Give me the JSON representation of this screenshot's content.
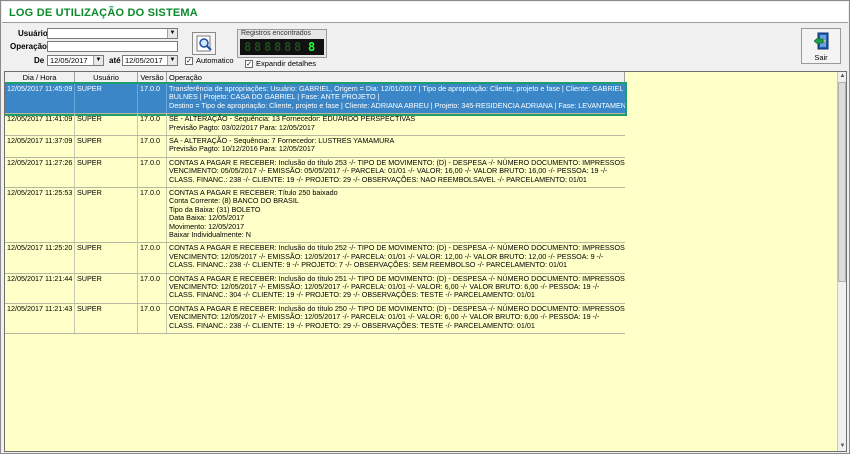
{
  "window": {
    "title": "LOG DE UTILIZAÇÃO DO SISTEMA"
  },
  "filters": {
    "usuario_label": "Usuário",
    "usuario_value": "",
    "operacao_label": "Operação",
    "operacao_value": "",
    "de_label": "De",
    "de_value": "12/05/2017",
    "ate_label": "até",
    "ate_value": "12/05/2017",
    "automatico_label": "Automatico",
    "automatico_checked": true,
    "expandir_label": "Expandir detalhes",
    "expandir_checked": true
  },
  "counter": {
    "label": "Registros encontrados",
    "value": "8"
  },
  "toolbar": {
    "sair_label": "Sair"
  },
  "grid": {
    "headers": [
      "Dia / Hora",
      "Usuário",
      "Versão",
      "Operação"
    ],
    "rows": [
      {
        "datetime": "12/05/2017 11:45:09",
        "user": "SUPER",
        "version": "17.0.0",
        "lines": [
          "Transferência de apropriações: Usuário: GABRIEL, Origem = Dia: 12/01/2017 | Tipo de apropriação: Cliente, projeto e fase | Cliente: GABRIEL VARELLA",
          "BULNES | Projeto: CASA DO GABRIEL | Fase: ANTE PROJETO |",
          "Destino = Tipo de apropriação: Cliente, projeto e fase | Cliente: ADRIANA ABREU | Projeto: 345-RESIDENCIA ADRIANA | Fase: LEVANTAMENTO |"
        ],
        "selected": true
      },
      {
        "datetime": "12/05/2017 11:41:09",
        "user": "SUPER",
        "version": "17.0.0",
        "lines": [
          "SE - ALTERAÇÃO - Sequência: 13 Fornecedor: EDUARDO PERSPECTIVAS",
          "Previsão Pagto: 03/02/2017 Para: 12/05/2017"
        ]
      },
      {
        "datetime": "12/05/2017 11:37:09",
        "user": "SUPER",
        "version": "17.0.0",
        "lines": [
          "SA - ALTERAÇÃO - Sequência: 7 Fornecedor: LUSTRES YAMAMURA",
          "Previsão Pagto: 10/12/2016 Para: 12/05/2017"
        ]
      },
      {
        "datetime": "12/05/2017 11:27:26",
        "user": "SUPER",
        "version": "17.0.0",
        "lines": [
          "CONTAS A PAGAR E RECEBER: Inclusão do título 253  -/-  TIPO DE MOVIMENTO: (D) - DESPESA  -/-  NÚMERO DOCUMENTO: IMPRESSOS  -/-",
          "VENCIMENTO: 05/05/2017  -/-  EMISSÃO: 05/05/2017  -/-  PARCELA: 01/01  -/-  VALOR: 16,00  -/-  VALOR BRUTO: 16,00  -/-  PESSOA: 19  -/-",
          "CLASS. FINANC.: 238  -/-  CLIENTE: 19  -/-  PROJETO: 29  -/-  OBSERVAÇÕES: NAO REEMBOLSAVEL  -/-  PARCELAMENTO: 01/01"
        ]
      },
      {
        "datetime": "12/05/2017 11:25:53",
        "user": "SUPER",
        "version": "17.0.0",
        "lines": [
          "CONTAS A PAGAR E RECEBER: Título 250 baixado",
          "Conta Corrente: (8) BANCO DO BRASIL",
          "Tipo da Baixa: (31) BOLETO",
          "Data Baixa: 12/05/2017",
          "Movimento: 12/05/2017",
          "Baixar Individualmente: N"
        ]
      },
      {
        "datetime": "12/05/2017 11:25:20",
        "user": "SUPER",
        "version": "17.0.0",
        "lines": [
          "CONTAS A PAGAR E RECEBER: Inclusão do título 252  -/-  TIPO DE MOVIMENTO: (D) - DESPESA  -/-  NÚMERO DOCUMENTO: IMPRESSOS  -/-",
          "VENCIMENTO: 12/05/2017  -/-  EMISSÃO: 12/05/2017  -/-  PARCELA: 01/01  -/-  VALOR: 12,00  -/-  VALOR BRUTO: 12,00  -/-  PESSOA: 9  -/-",
          "CLASS. FINANC.: 238  -/-  CLIENTE: 9  -/-  PROJETO: 7  -/-  OBSERVAÇÕES: SEM REEMBOLSO  -/-  PARCELAMENTO: 01/01"
        ]
      },
      {
        "datetime": "12/05/2017 11:21:44",
        "user": "SUPER",
        "version": "17.0.0",
        "lines": [
          "CONTAS A PAGAR E RECEBER: Inclusão do título 251  -/-  TIPO DE MOVIMENTO: (D) - DESPESA  -/-  NÚMERO DOCUMENTO: IMPRESSOS  -/-",
          "VENCIMENTO: 12/05/2017  -/-  EMISSÃO: 12/05/2017  -/-  PARCELA: 01/01  -/-  VALOR: 6,00  -/-  VALOR BRUTO: 6,00  -/-  PESSOA: 19  -/-",
          "CLASS. FINANC.: 304  -/-  CLIENTE: 19  -/-  PROJETO: 29  -/-  OBSERVAÇÕES: TESTE  -/-  PARCELAMENTO: 01/01"
        ]
      },
      {
        "datetime": "12/05/2017 11:21:43",
        "user": "SUPER",
        "version": "17.0.0",
        "lines": [
          "CONTAS A PAGAR E RECEBER: Inclusão do título 250  -/-  TIPO DE MOVIMENTO: (D) - DESPESA  -/-  NÚMERO DOCUMENTO: IMPRESSOS  -/-",
          "VENCIMENTO: 12/05/2017  -/-  EMISSÃO: 12/05/2017  -/-  PARCELA: 01/01  -/-  VALOR: 6,00  -/-  VALOR BRUTO: 6,00  -/-  PESSOA: 19  -/-",
          "CLASS. FINANC.: 238  -/-  CLIENTE: 19  -/-  PROJETO: 29  -/-  OBSERVAÇÕES: TESTE  -/-  PARCELAMENTO: 01/01"
        ]
      }
    ]
  },
  "colors": {
    "title": "#0a8a2a",
    "grid_background": "#ffffc8",
    "selected_row": "#3b86c6",
    "counter_digit": "#22ff33"
  },
  "icons": [
    "search-icon",
    "exit-door-icon",
    "dropdown-arrow-icon",
    "checkbox-check-icon"
  ]
}
